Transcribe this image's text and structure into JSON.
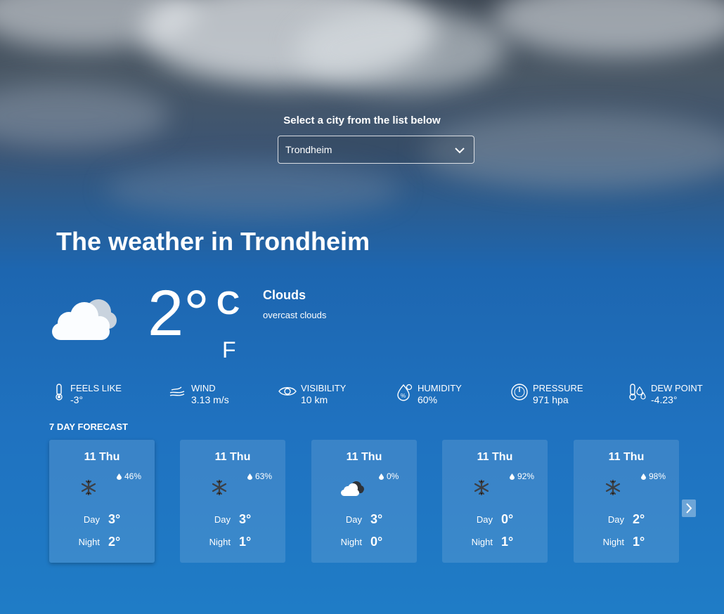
{
  "selector": {
    "label": "Select a city from the list below",
    "selected_city": "Trondheim"
  },
  "current": {
    "title": "The weather in Trondheim",
    "icon": "clouds-icon",
    "temperature": "2°",
    "unit_c": "C",
    "unit_f": "F",
    "condition": "Clouds",
    "description": "overcast clouds"
  },
  "metrics": [
    {
      "label": "FEELS LIKE",
      "value": "-3°",
      "icon": "thermometer-icon"
    },
    {
      "label": "WIND",
      "value": "3.13 m/s",
      "icon": "wind-icon"
    },
    {
      "label": "VISIBILITY",
      "value": "10 km",
      "icon": "eye-icon"
    },
    {
      "label": "HUMIDITY",
      "value": "60%",
      "icon": "humidity-icon"
    },
    {
      "label": "PRESSURE",
      "value": "971 hpa",
      "icon": "barometer-icon"
    },
    {
      "label": "DEW POINT",
      "value": "-4.23°",
      "icon": "dew-point-icon"
    }
  ],
  "forecast": {
    "title": "7 DAY FORECAST",
    "day_label": "Day",
    "night_label": "Night",
    "days": [
      {
        "date": "11 Thu",
        "rain": "46%",
        "icon": "snowflake-icon",
        "day": "3°",
        "night": "2°"
      },
      {
        "date": "11 Thu",
        "rain": "63%",
        "icon": "snowflake-icon",
        "day": "3°",
        "night": "1°"
      },
      {
        "date": "11 Thu",
        "rain": "0%",
        "icon": "cloud-icon",
        "day": "3°",
        "night": "0°"
      },
      {
        "date": "11 Thu",
        "rain": "92%",
        "icon": "snowflake-icon",
        "day": "0°",
        "night": "1°"
      },
      {
        "date": "11 Thu",
        "rain": "98%",
        "icon": "snowflake-icon",
        "day": "2°",
        "night": "1°"
      }
    ]
  },
  "colors": {
    "background_top": "#3a4450",
    "background_bottom": "#1f7cc6",
    "card": "rgba(255,255,255,0.12)"
  }
}
